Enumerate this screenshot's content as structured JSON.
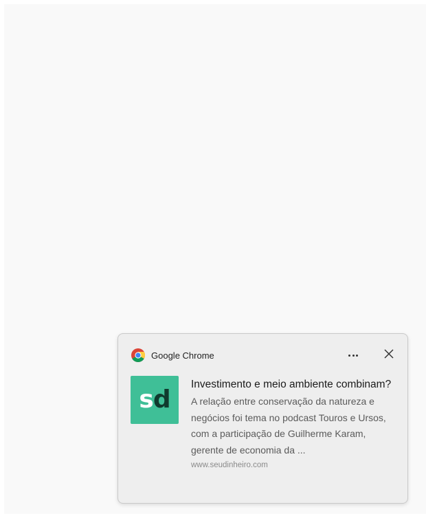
{
  "notification": {
    "app_name": "Google Chrome",
    "app_icon": "chrome-icon",
    "more_label": "•••",
    "close_icon": "close-icon",
    "logo": {
      "letter_1": "s",
      "letter_2": "d",
      "background_color": "#3fbf97",
      "accent_color": "#103a2e"
    },
    "title": "Investimento e meio ambiente combinam?",
    "body": "A relação entre conservação da natureza e negócios foi tema no podcast Touros e Ursos, com a participação de Guilherme Karam, gerente de economia da ...",
    "source": "www.seudinheiro.com"
  }
}
